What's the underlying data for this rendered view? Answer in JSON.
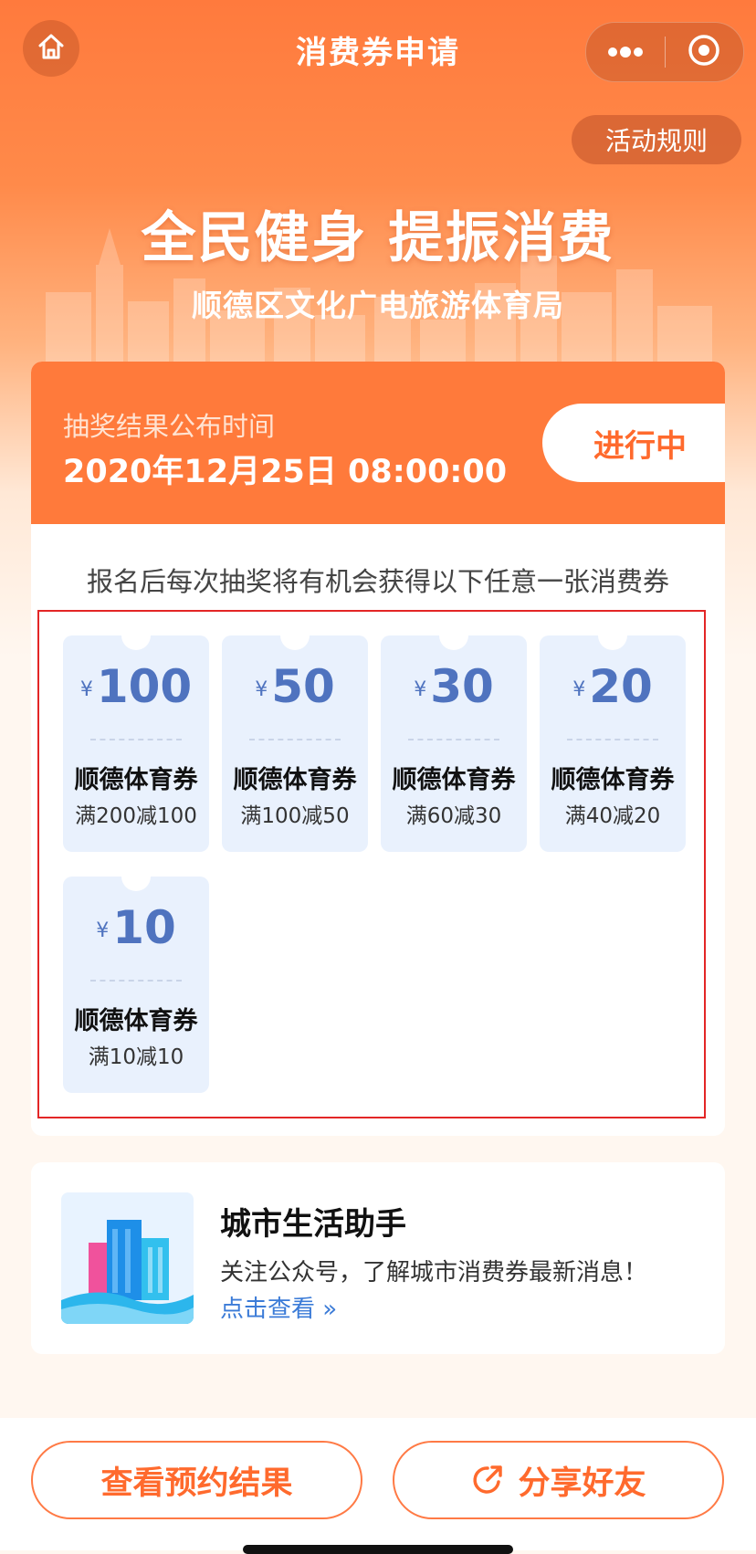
{
  "nav": {
    "title": "消费券申请"
  },
  "header": {
    "rules_label": "活动规则",
    "hero_title": "全民健身 提振消费",
    "hero_subtitle": "顺德区文化广电旅游体育局"
  },
  "draw": {
    "label": "抽奖结果公布时间",
    "time": "2020年12月25日 08:00:00",
    "status": "进行中"
  },
  "intro": "报名后每次抽奖将有机会获得以下任意一张消费券",
  "coupons": [
    {
      "currency": "¥",
      "amount": "100",
      "name": "顺德体育券",
      "condition": "满200减100"
    },
    {
      "currency": "¥",
      "amount": "50",
      "name": "顺德体育券",
      "condition": "满100减50"
    },
    {
      "currency": "¥",
      "amount": "30",
      "name": "顺德体育券",
      "condition": "满60减30"
    },
    {
      "currency": "¥",
      "amount": "20",
      "name": "顺德体育券",
      "condition": "满40减20"
    },
    {
      "currency": "¥",
      "amount": "10",
      "name": "顺德体育券",
      "condition": "满10减10"
    }
  ],
  "helper": {
    "title": "城市生活助手",
    "description": "关注公众号，了解城市消费券最新消息！",
    "link": "点击查看 »"
  },
  "actions": {
    "view_result": "查看预约结果",
    "share": "分享好友"
  },
  "colors": {
    "brand_orange": "#ff7a3b",
    "coupon_blue": "#4f73bf",
    "link_blue": "#3b7bd7",
    "highlight_red": "#e32626"
  },
  "icons": [
    "home-icon",
    "more-dots-icon",
    "target-icon",
    "share-icon",
    "building-illustration"
  ]
}
